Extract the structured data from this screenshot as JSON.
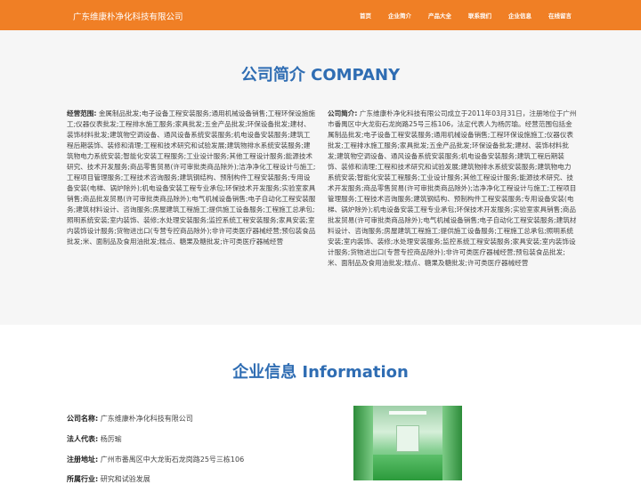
{
  "header": {
    "brand": "广东维康朴净化科技有限公司",
    "nav": [
      "首页",
      "企业简介",
      "产品大全",
      "联系我们",
      "企业信息",
      "在线留言"
    ]
  },
  "about": {
    "title": "公司简介 COMPANY",
    "scope_label": "经营范围:",
    "scope_text": "金属制品批发;电子设备工程安装服务;通用机械设备销售;工程环保设施施工;仪器仪表批发;工程排水施工服务;家具批发;五金产品批发;环保设备批发;建材、装饰材料批发;建筑物空调设备、通风设备系统安装服务;机电设备安装服务;建筑工程后期装饰、装修和清理;工程和技术研究和试验发展;建筑物排水系统安装服务;建筑物电力系统安装;智能化安装工程服务;工业设计服务;其他工程设计服务;能源技术研究、技术开发服务;商品零售贸易(许可审批类商品除外);洁净净化工程设计与施工;工程项目管理服务;工程技术咨询服务;建筑钢结构、预制构件工程安装服务;专用设备安装(电梯、锅炉除外);机电设备安装工程专业承包;环保技术开发服务;实验室家具销售;商品批发贸易(许可审批类商品除外);电气机械设备销售;电子自动化工程安装服务;建筑材料设计、咨询服务;房屋建筑工程施工;提供施工设备服务;工程施工总承包;照明系统安装;室内装饰、装修;水处理安装服务;监控系统工程安装服务;家具安装;室内装饰设计服务;货物进出口(专营专控商品除外);非许可类医疗器械经营;预包装食品批发;米、面制品及食用油批发;糕点、糖果及糖批发;许可类医疗器械经营",
    "intro_label": "公司简介:",
    "intro_text": "广东维康朴净化科技有限公司成立于2011年03月31日，注册地位于广州市番禺区中大龙街石龙岗路25号三栋106，法定代表人为杨厉瑜。经营范围包括金属制品批发;电子设备工程安装服务;通用机械设备销售;工程环保设施施工;仪器仪表批发;工程排水施工服务;家具批发;五金产品批发;环保设备批发;建材、装饰材料批发;建筑物空调设备、通风设备系统安装服务;机电设备安装服务;建筑工程后期装饰、装修和清理;工程和技术研究和试验发展;建筑物排水系统安装服务;建筑物电力系统安装;智能化安装工程服务;工业设计服务;其他工程设计服务;能源技术研究、技术开发服务;商品零售贸易(许可审批类商品除外);洁净净化工程设计与施工;工程项目管理服务;工程技术咨询服务;建筑钢结构、预制构件工程安装服务;专用设备安装(电梯、锅炉除外);机电设备安装工程专业承包;环保技术开发服务;实验室家具销售;商品批发贸易(许可审批类商品除外);电气机械设备销售;电子自动化工程安装服务;建筑材料设计、咨询服务;房屋建筑工程施工;提供施工设备服务;工程施工总承包;照明系统安装;室内装饰、装修;水处理安装服务;监控系统工程安装服务;家具安装;室内装饰设计服务;货物进出口(专营专控商品除外);非许可类医疗器械经营;预包装食品批发;米、面制品及食用油批发;糕点、糖果及糖批发;许可类医疗器械经营"
  },
  "info": {
    "title": "企业信息 Information",
    "rows": [
      {
        "label": "公司名称:",
        "value": "广东维康朴净化科技有限公司"
      },
      {
        "label": "法人代表:",
        "value": "杨厉瑜"
      },
      {
        "label": "注册地址:",
        "value": "广州市番禺区中大龙街石龙岗路25号三栋106"
      },
      {
        "label": "所属行业:",
        "value": "研究和试验发展"
      }
    ]
  }
}
